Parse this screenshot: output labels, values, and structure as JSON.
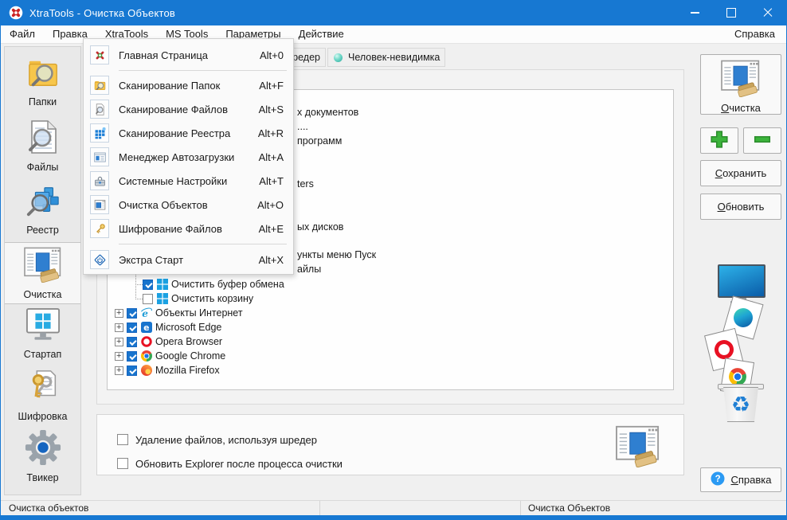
{
  "titlebar": {
    "title": "XtraTools - Очистка Объектов"
  },
  "menubar": {
    "items": [
      "Файл",
      "Правка",
      "XtraTools",
      "MS Tools",
      "Параметры",
      "Действие"
    ],
    "help": "Справка"
  },
  "menu": {
    "items": [
      {
        "label": "Главная Страница",
        "shortcut": "Alt+0",
        "icon": "home-icon"
      },
      {
        "label": "Сканирование Папок",
        "shortcut": "Alt+F",
        "icon": "folder-scan-icon"
      },
      {
        "label": "Сканирование Файлов",
        "shortcut": "Alt+S",
        "icon": "file-scan-icon"
      },
      {
        "label": "Сканирование Реестра",
        "shortcut": "Alt+R",
        "icon": "registry-scan-icon"
      },
      {
        "label": "Менеджер Автозагрузки",
        "shortcut": "Alt+A",
        "icon": "autostart-manager-icon"
      },
      {
        "label": "Системные Настройки",
        "shortcut": "Alt+T",
        "icon": "system-settings-icon"
      },
      {
        "label": "Очистка Объектов",
        "shortcut": "Alt+O",
        "icon": "object-cleanup-icon"
      },
      {
        "label": "Шифрование Файлов",
        "shortcut": "Alt+E",
        "icon": "file-encryption-icon"
      },
      {
        "label": "Экстра Старт",
        "shortcut": "Alt+X",
        "icon": "extra-start-icon"
      }
    ]
  },
  "sidebar": {
    "items": [
      {
        "label": "Папки"
      },
      {
        "label": "Файлы"
      },
      {
        "label": "Реестр"
      },
      {
        "label": "Очистка",
        "selected": true
      },
      {
        "label": "Стартап"
      },
      {
        "label": "Шифровка"
      },
      {
        "label": "Твикер"
      }
    ]
  },
  "tabs": {
    "tab1_fragment": "редер",
    "tab2": "Человек-невидимка"
  },
  "tree": {
    "fragments": [
      "х документов",
      "....",
      "программ",
      "ters",
      "ых дисков",
      "ункты меню Пуск",
      "айлы"
    ],
    "items": [
      {
        "label": "Очистить буфер обмена",
        "checked": true,
        "icon": "windows-logo"
      },
      {
        "label": "Очистить корзину",
        "checked": false,
        "icon": "windows-logo"
      },
      {
        "label": "Объекты Интернет",
        "checked": true,
        "icon": "ie-logo"
      },
      {
        "label": "Microsoft Edge",
        "checked": true,
        "icon": "edge-logo"
      },
      {
        "label": "Opera Browser",
        "checked": true,
        "icon": "opera-logo"
      },
      {
        "label": "Google Chrome",
        "checked": true,
        "icon": "chrome-logo"
      },
      {
        "label": "Mozilla Firefox",
        "checked": true,
        "icon": "firefox-logo"
      }
    ]
  },
  "options": {
    "option1": "Удаление файлов, используя шредер",
    "option2": "Обновить Explorer после процесса очистки"
  },
  "right_panel": {
    "clean": "Очистка",
    "save": "Сохранить",
    "refresh": "Обновить",
    "help": "Справка"
  },
  "statusbar": {
    "left": "Очистка объектов",
    "right": "Очистка Объектов"
  },
  "colors": {
    "titlebar": "#1778d2",
    "accent_green": "#3cb43c",
    "checkbox_blue": "#1874cd"
  }
}
